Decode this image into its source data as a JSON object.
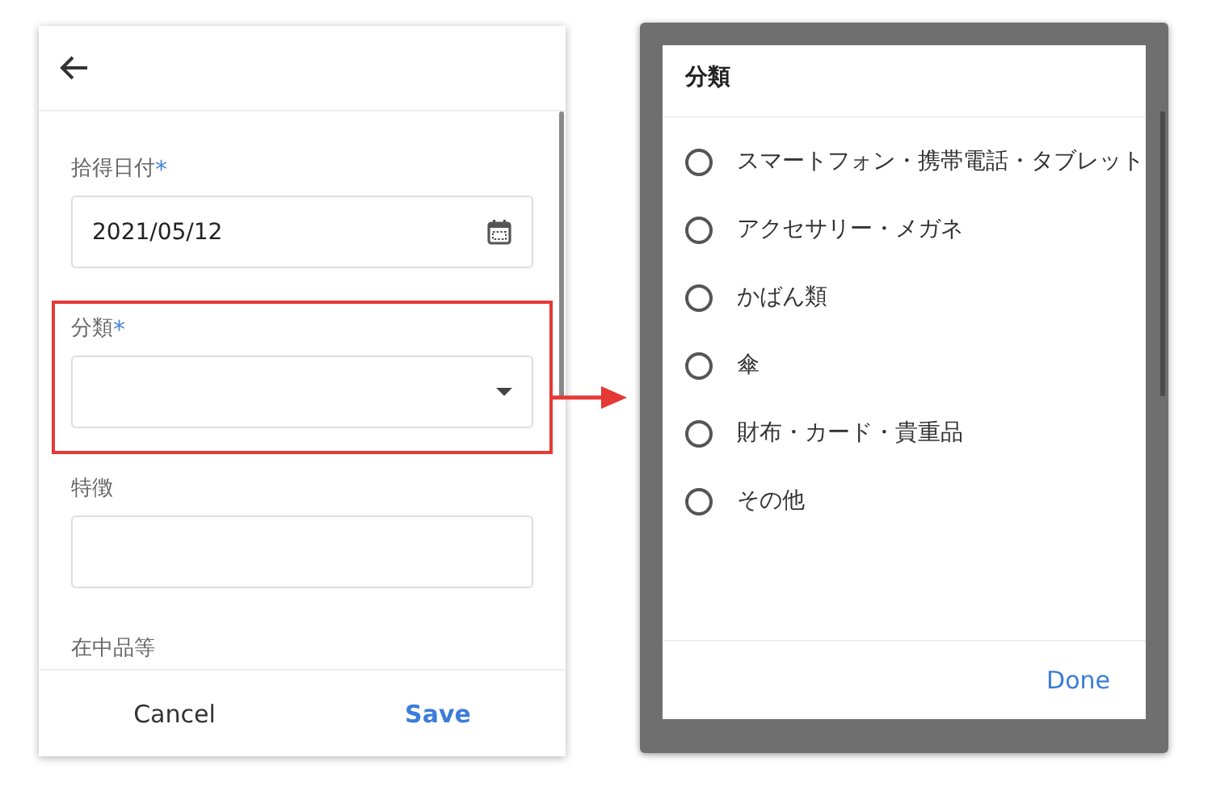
{
  "form": {
    "fields": [
      {
        "label": "拾得日付",
        "required_mark": "*",
        "kind": "date",
        "value": "2021/05/12",
        "highlighted": false
      },
      {
        "label": "分類",
        "required_mark": "*",
        "kind": "select",
        "highlighted": true
      },
      {
        "label": "特徴",
        "kind": "text",
        "highlighted": false
      },
      {
        "label": "在中品等",
        "kind": "label_only",
        "highlighted": false
      }
    ],
    "buttons": [
      {
        "label": "Cancel",
        "primary": false
      },
      {
        "label": "Save",
        "primary": true
      }
    ]
  },
  "dialog": {
    "title": "分類",
    "options": [
      {
        "label": "スマートフォン・携帯電話・タブレット",
        "selected": false
      },
      {
        "label": "アクセサリー・メガネ",
        "selected": false
      },
      {
        "label": "かばん類",
        "selected": false
      },
      {
        "label": "傘",
        "selected": false
      },
      {
        "label": "財布・カード・貴重品",
        "selected": false
      },
      {
        "label": "その他",
        "selected": false
      }
    ],
    "button": "Done"
  }
}
